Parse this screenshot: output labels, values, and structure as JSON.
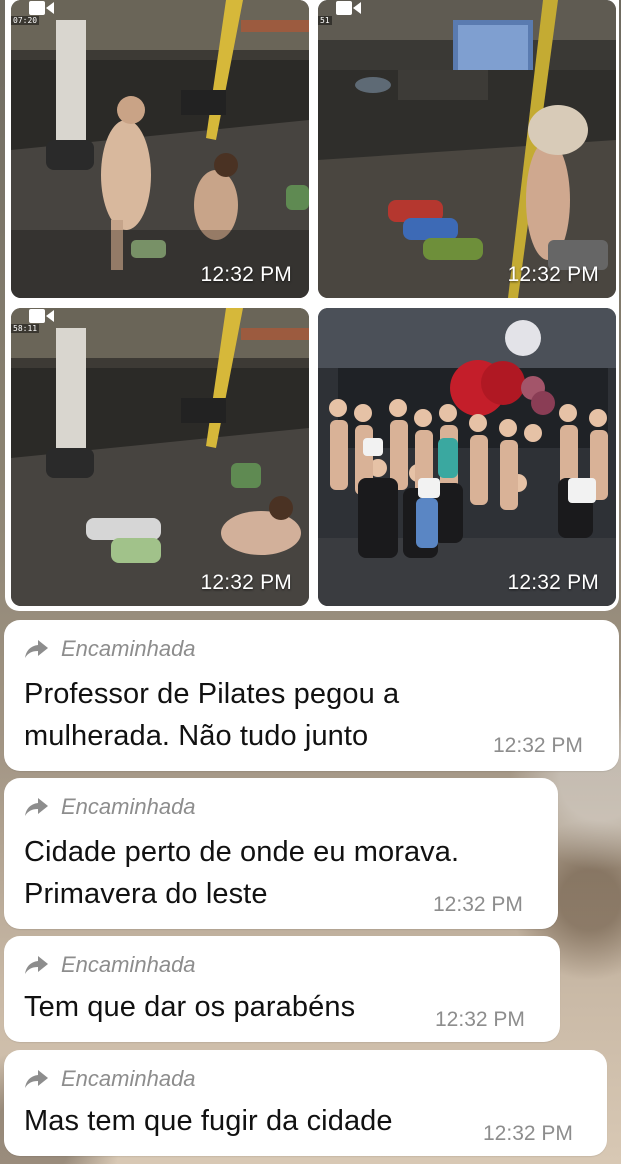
{
  "media": [
    {
      "time": "12:32 PM",
      "overlay": "07:20",
      "kind": "video"
    },
    {
      "time": "12:32 PM",
      "overlay": "51",
      "kind": "video"
    },
    {
      "time": "12:32 PM",
      "overlay": "58:11",
      "kind": "video"
    },
    {
      "time": "12:32 PM",
      "kind": "photo"
    }
  ],
  "messages": [
    {
      "forwarded_label": "Encaminhada",
      "text": "Professor de Pilates pegou a\nmulherada. Não tudo junto",
      "time": "12:32 PM"
    },
    {
      "forwarded_label": "Encaminhada",
      "text": "Cidade perto de onde eu morava.\nPrimavera do leste",
      "time": "12:32 PM"
    },
    {
      "forwarded_label": "Encaminhada",
      "text": "Tem que dar os parabéns",
      "time": "12:32 PM"
    },
    {
      "forwarded_label": "Encaminhada",
      "text": "Mas tem que fugir da cidade",
      "time": "12:32 PM"
    }
  ],
  "icons": {
    "video": "video-camera-icon",
    "forward": "forward-arrow-icon"
  },
  "colors": {
    "bubble": "#ffffff",
    "meta_text": "#8d8d8d",
    "message_text": "#111111"
  }
}
